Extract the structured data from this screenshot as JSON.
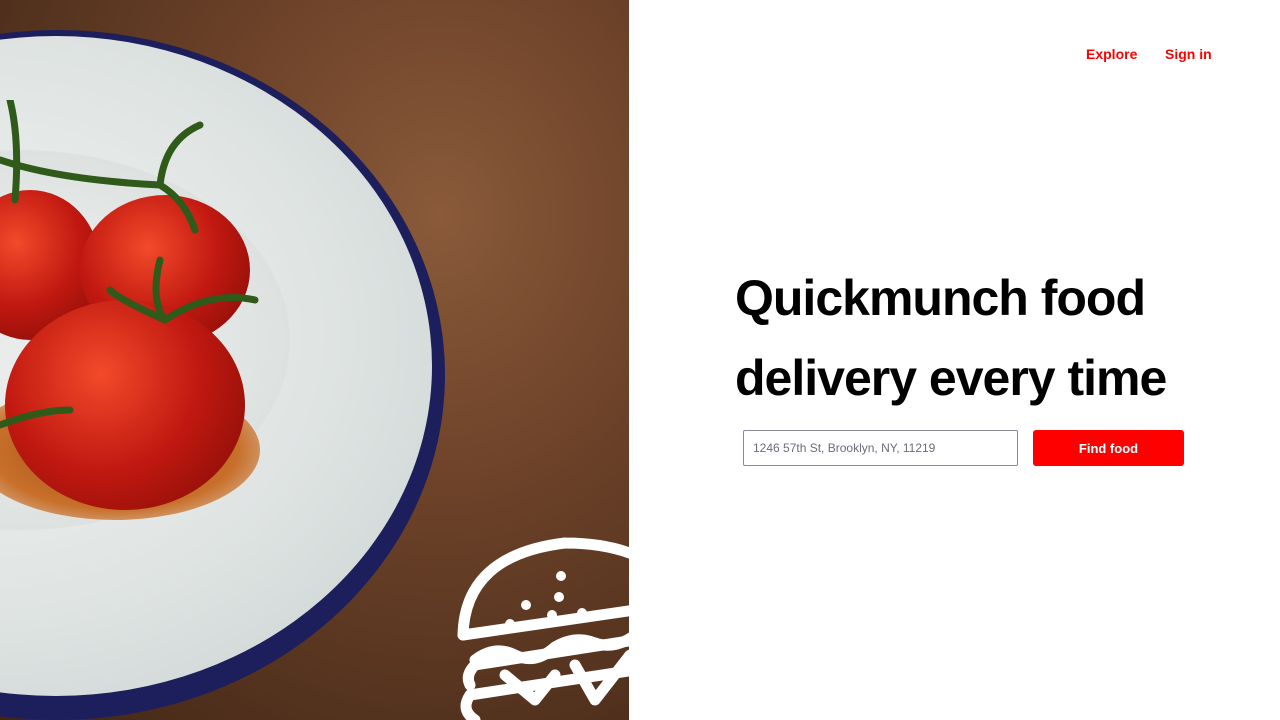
{
  "nav": {
    "explore": "Explore",
    "sign_in": "Sign in"
  },
  "hero": {
    "headline": "Quickmunch food delivery every time"
  },
  "search": {
    "placeholder": "1246 57th St, Brooklyn, NY, 11219",
    "value": "",
    "button": "Find food"
  },
  "colors": {
    "accent": "#ff0000"
  }
}
